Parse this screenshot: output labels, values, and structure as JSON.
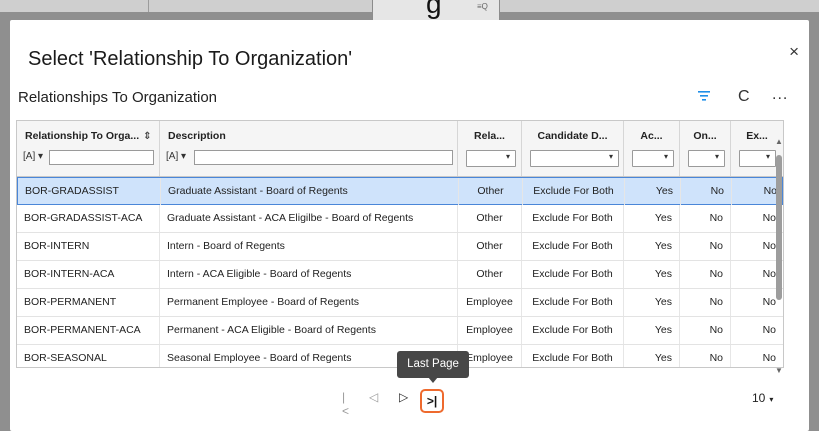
{
  "background": {
    "glyph": "g",
    "field_icon": "≡Q"
  },
  "dialog": {
    "title": "Select 'Relationship To Organization'",
    "close": "×"
  },
  "grid": {
    "title": "Relationships To Organization",
    "refresh": "C",
    "more": "...",
    "columns": [
      {
        "label": "Relationship To Orga...",
        "sort": "⇕",
        "operator": "[A] ▾"
      },
      {
        "label": "Description",
        "operator": "[A] ▾"
      },
      {
        "label": "Rela..."
      },
      {
        "label": "Candidate D..."
      },
      {
        "label": "Ac..."
      },
      {
        "label": "On..."
      },
      {
        "label": "Ex..."
      }
    ],
    "rows": [
      [
        "BOR-GRADASSIST",
        "Graduate Assistant - Board of Regents",
        "Other",
        "Exclude For Both",
        "Yes",
        "No",
        "No"
      ],
      [
        "BOR-GRADASSIST-ACA",
        "Graduate Assistant - ACA Eligilbe - Board of Regents",
        "Other",
        "Exclude For Both",
        "Yes",
        "No",
        "No"
      ],
      [
        "BOR-INTERN",
        "Intern - Board of Regents",
        "Other",
        "Exclude For Both",
        "Yes",
        "No",
        "No"
      ],
      [
        "BOR-INTERN-ACA",
        "Intern - ACA Eligible - Board of Regents",
        "Other",
        "Exclude For Both",
        "Yes",
        "No",
        "No"
      ],
      [
        "BOR-PERMANENT",
        "Permanent Employee - Board of Regents",
        "Employee",
        "Exclude For Both",
        "Yes",
        "No",
        "No"
      ],
      [
        "BOR-PERMANENT-ACA",
        "Permanent - ACA Eligible - Board of Regents",
        "Employee",
        "Exclude For Both",
        "Yes",
        "No",
        "No"
      ],
      [
        "BOR-SEASONAL",
        "Seasonal Employee - Board of Regents",
        "Employee",
        "Exclude For Both",
        "Yes",
        "No",
        "No"
      ]
    ],
    "selected_row": 0
  },
  "pager": {
    "first": "|<",
    "prev": "◁",
    "next": "▷",
    "last": ">|",
    "tooltip": "Last Page",
    "page_size": "10"
  },
  "colors": {
    "selected_row": "#cfe3fb",
    "selected_border": "#4a86d8",
    "highlight_outline": "#ee6a2e",
    "filter_icon": "#1f8fe8"
  },
  "icons": [
    "filter-icon",
    "refresh-icon",
    "more-icon",
    "close-icon",
    "sort-icon"
  ]
}
